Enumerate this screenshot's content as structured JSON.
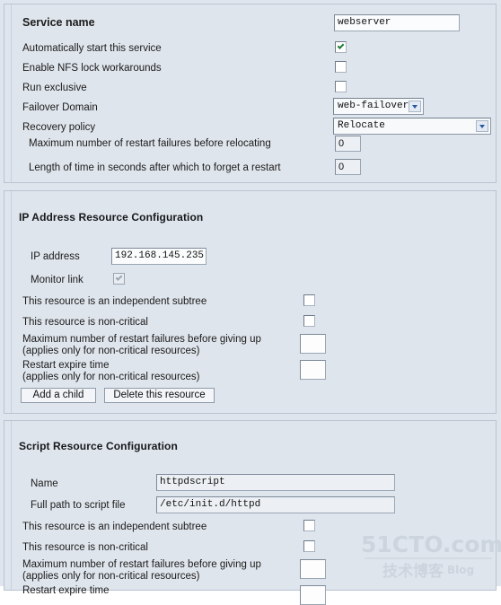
{
  "service": {
    "name_label": "Service name",
    "name_value": "webserver",
    "autostart_label": "Automatically start this service",
    "autostart_checked": true,
    "nfslock_label": "Enable NFS lock workarounds",
    "nfslock_checked": false,
    "exclusive_label": "Run exclusive",
    "exclusive_checked": false,
    "failover_label": "Failover Domain",
    "failover_value": "web-failover",
    "recovery_label": "Recovery policy",
    "recovery_value": "Relocate",
    "max_restart_label": "Maximum number of restart failures before relocating",
    "max_restart_value": "0",
    "forget_restart_label": "Length of time in seconds after which to forget a restart",
    "forget_restart_value": "0"
  },
  "ip_resource": {
    "title": "IP Address Resource Configuration",
    "ip_label": "IP address",
    "ip_value": "192.168.145.235",
    "monitor_label": "Monitor link",
    "monitor_checked": true,
    "subtree_label": "This resource is an independent subtree",
    "subtree_checked": false,
    "noncritical_label": "This resource is non-critical",
    "noncritical_checked": false,
    "max_fail_label": "Maximum number of restart failures before giving up",
    "max_fail_sub": "(applies only for non-critical resources)",
    "max_fail_value": "",
    "expire_label": "Restart expire time",
    "expire_sub": "(applies only for non-critical resources)",
    "expire_value": "",
    "add_child_button": "Add a child",
    "delete_button": "Delete this resource"
  },
  "script_resource": {
    "title": "Script Resource Configuration",
    "name_label": "Name",
    "name_value": "httpdscript",
    "path_label": "Full path to script file",
    "path_value": "/etc/init.d/httpd",
    "subtree_label": "This resource is an independent subtree",
    "subtree_checked": false,
    "noncritical_label": "This resource is non-critical",
    "noncritical_checked": false,
    "max_fail_label": "Maximum number of restart failures before giving up",
    "max_fail_sub": "(applies only for non-critical resources)",
    "max_fail_value": "",
    "expire_label": "Restart expire time"
  },
  "watermark": {
    "top": "51CTO.com",
    "bottom": "技术博客",
    "blog": "Blog"
  },
  "colors": {
    "background": "#dfe5ec",
    "panel_border": "#b9c4d2",
    "check_green": "#1e7d32",
    "select_arrow": "#29599e"
  }
}
